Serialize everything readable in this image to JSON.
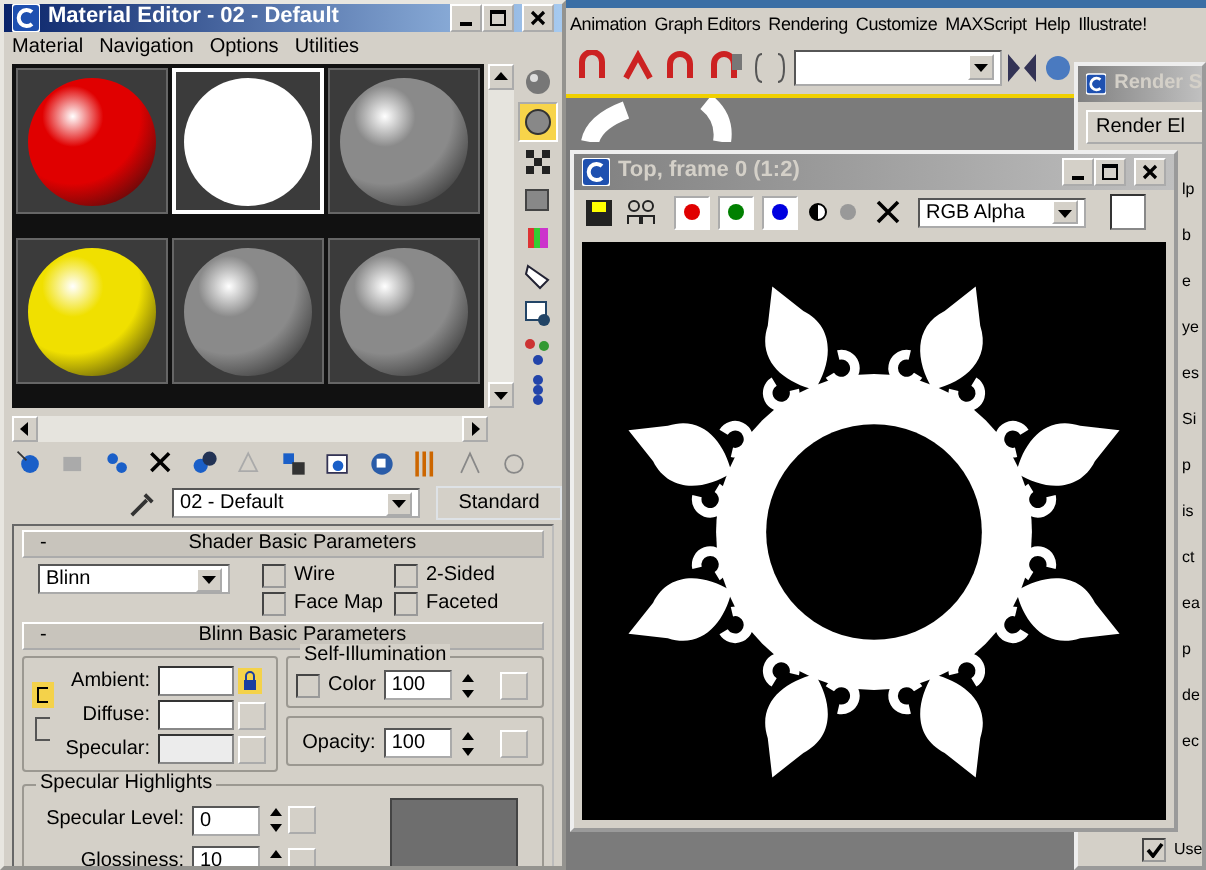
{
  "material_editor": {
    "title": "Material Editor - 02 - Default",
    "menu": [
      "Material",
      "Navigation",
      "Options",
      "Utilities"
    ],
    "slots": [
      {
        "color": "#e00000",
        "selected": false
      },
      {
        "color": "#ffffff",
        "selected": true
      },
      {
        "color": "#8a8a8a",
        "selected": false
      },
      {
        "color": "#f0e000",
        "selected": false
      },
      {
        "color": "#8a8a8a",
        "selected": false
      },
      {
        "color": "#8a8a8a",
        "selected": false
      }
    ],
    "material_name": "02 - Default",
    "material_type": "Standard",
    "shader_rollout": {
      "toggle": "-",
      "title": "Shader Basic Parameters",
      "shader": "Blinn",
      "options": [
        {
          "label": "Wire",
          "checked": false
        },
        {
          "label": "2-Sided",
          "checked": false
        },
        {
          "label": "Face Map",
          "checked": false
        },
        {
          "label": "Faceted",
          "checked": false
        }
      ]
    },
    "blinn_rollout": {
      "toggle": "-",
      "title": "Blinn Basic Parameters",
      "colors": [
        {
          "label": "Ambient:",
          "color": "#ffffff"
        },
        {
          "label": "Diffuse:",
          "color": "#ffffff"
        },
        {
          "label": "Specular:",
          "color": "#ececec"
        }
      ],
      "self_illumination": {
        "title": "Self-Illumination",
        "label": "Color",
        "checked": false,
        "value": "100"
      },
      "opacity": {
        "label": "Opacity:",
        "value": "100"
      },
      "specular_highlights": {
        "title": "Specular Highlights",
        "fields": [
          {
            "label": "Specular Level:",
            "value": "0"
          },
          {
            "label": "Glossiness:",
            "value": "10"
          }
        ]
      }
    }
  },
  "main_menu": [
    "Animation",
    "Graph Editors",
    "Rendering",
    "Customize",
    "MAXScript",
    "Help",
    "Illustrate!"
  ],
  "render_setup": {
    "title": "Render S",
    "button": "Render El",
    "fragments": [
      "lp",
      "b",
      "e",
      "ye",
      "es",
      "Si",
      "p",
      "is",
      "ct",
      "ea",
      "p",
      "de",
      "ec"
    ],
    "use_option": {
      "label": "Use",
      "checked": true
    }
  },
  "render_frame": {
    "title": "Top, frame 0 (1:2)",
    "channels": [
      {
        "color": "#e00000",
        "on": true
      },
      {
        "color": "#008000",
        "on": true
      },
      {
        "color": "#0000e0",
        "on": true
      }
    ],
    "channel_display": "RGB Alpha"
  }
}
